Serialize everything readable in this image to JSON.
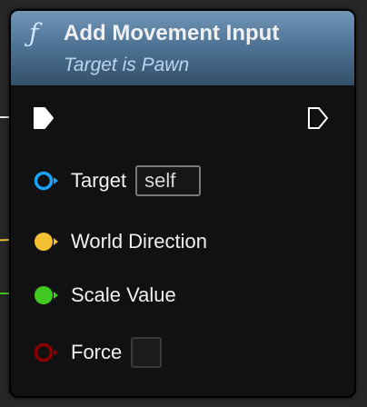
{
  "node": {
    "title": "Add Movement Input",
    "subtitle": "Target is Pawn",
    "function_icon": "function-icon",
    "header_color": "#4f7496"
  },
  "pins": {
    "exec_in": {
      "icon": "exec-pin-icon",
      "color": "#ffffff",
      "connected": true
    },
    "exec_out": {
      "icon": "exec-pin-icon",
      "color": "#ffffff",
      "connected": false
    },
    "target": {
      "label": "Target",
      "value": "self",
      "color": "#1aa3ff",
      "connected": false
    },
    "world_direction": {
      "label": "World Direction",
      "color": "#f2c032",
      "connected": true
    },
    "scale_value": {
      "label": "Scale Value",
      "color": "#41c91f",
      "connected": true
    },
    "force": {
      "label": "Force",
      "color": "#8c0000",
      "checked": false,
      "connected": false
    }
  }
}
